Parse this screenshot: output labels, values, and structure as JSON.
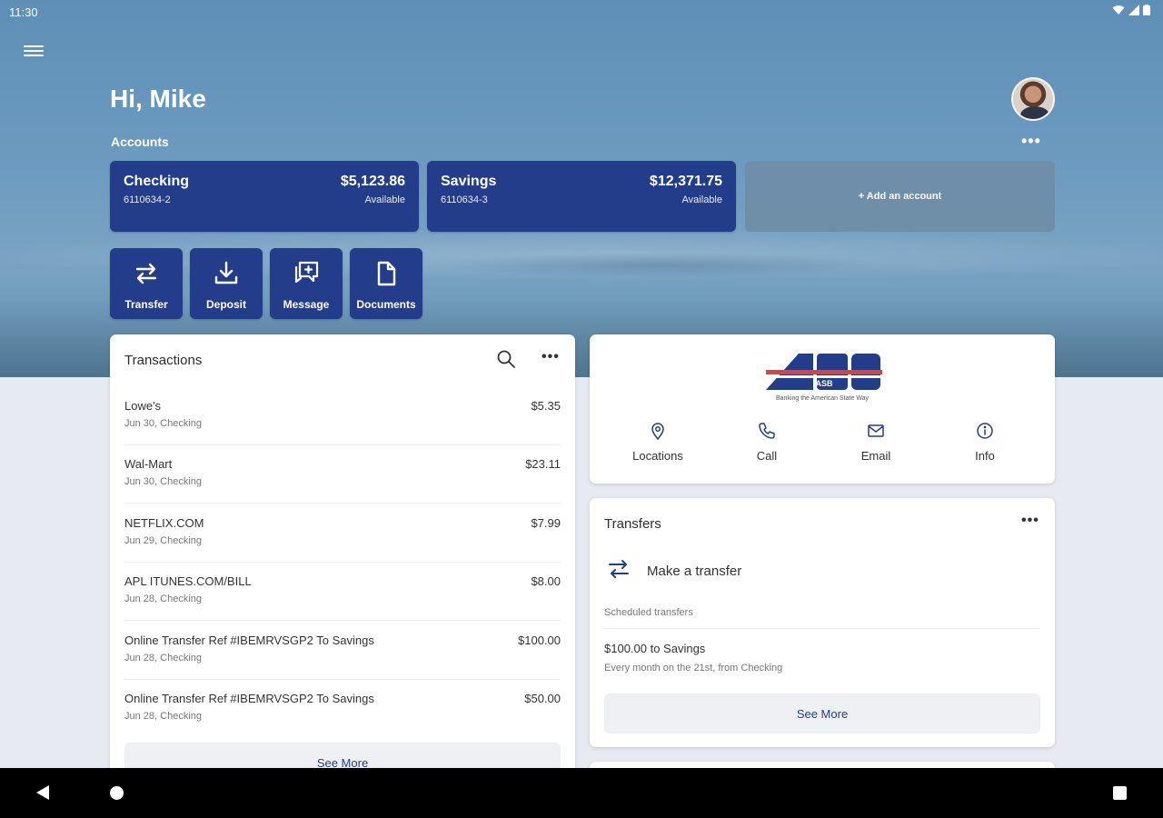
{
  "status_bar": {
    "time": "11:30"
  },
  "header": {
    "greeting": "Hi, Mike",
    "accounts_label": "Accounts",
    "more": "•••"
  },
  "accounts": [
    {
      "name": "Checking",
      "number": "6110634-2",
      "balance": "$5,123.86",
      "available_label": "Available"
    },
    {
      "name": "Savings",
      "number": "6110634-3",
      "balance": "$12,371.75",
      "available_label": "Available"
    }
  ],
  "add_account_label": "+ Add an account",
  "quick_actions": [
    {
      "label": "Transfer",
      "icon": "transfer-icon"
    },
    {
      "label": "Deposit",
      "icon": "deposit-icon"
    },
    {
      "label": "Message",
      "icon": "message-icon"
    },
    {
      "label": "Documents",
      "icon": "documents-icon"
    }
  ],
  "transactions": {
    "title": "Transactions",
    "more": "•••",
    "items": [
      {
        "description": "Lowe's",
        "meta": "Jun 30, Checking",
        "amount": "$5.35"
      },
      {
        "description": "Wal-Mart",
        "meta": "Jun 30, Checking",
        "amount": "$23.11"
      },
      {
        "description": "NETFLIX.COM",
        "meta": "Jun 29, Checking",
        "amount": "$7.99"
      },
      {
        "description": "APL ITUNES.COM/BILL",
        "meta": "Jun 28, Checking",
        "amount": "$8.00"
      },
      {
        "description": "Online Transfer Ref #IBEMRVSGP2 To Savings",
        "meta": "Jun 28, Checking",
        "amount": "$100.00"
      },
      {
        "description": "Online Transfer Ref #IBEMRVSGP2 To Savings",
        "meta": "Jun 28, Checking",
        "amount": "$50.00"
      }
    ],
    "see_more": "See More"
  },
  "bank": {
    "logo_text": "ASB",
    "tagline": "Banking the American State Way",
    "actions": [
      {
        "label": "Locations",
        "icon": "location-pin-icon"
      },
      {
        "label": "Call",
        "icon": "phone-icon"
      },
      {
        "label": "Email",
        "icon": "email-icon"
      },
      {
        "label": "Info",
        "icon": "info-icon"
      }
    ]
  },
  "transfers": {
    "title": "Transfers",
    "more": "•••",
    "make_label": "Make a transfer",
    "scheduled_label": "Scheduled transfers",
    "scheduled": [
      {
        "title": "$100.00 to Savings",
        "subtitle": "Every month on the 21st, from Checking"
      }
    ],
    "see_more": "See More"
  },
  "colors": {
    "brand": "#233d8b",
    "hero": "#6d9bc0",
    "background": "#e7eaf0"
  }
}
